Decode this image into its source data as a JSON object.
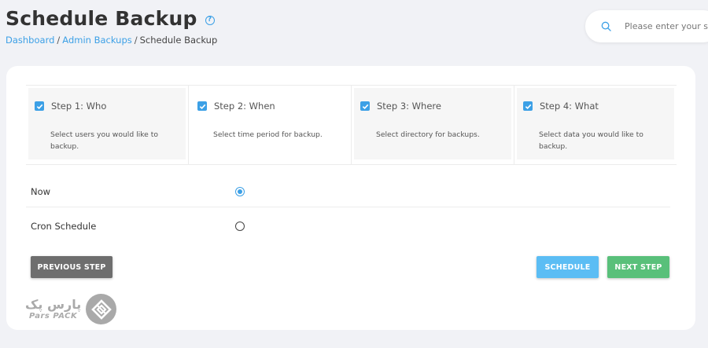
{
  "page": {
    "title": "Schedule Backup"
  },
  "breadcrumb": {
    "items": [
      "Dashboard",
      "Admin Backups",
      "Schedule Backup"
    ],
    "separator": "/"
  },
  "search": {
    "placeholder": "Please enter your search"
  },
  "steps": [
    {
      "title": "Step 1: Who",
      "description": "Select users you would like to backup.",
      "checked": true,
      "active": false
    },
    {
      "title": "Step 2: When",
      "description": "Select time period for backup.",
      "checked": true,
      "active": true
    },
    {
      "title": "Step 3: Where",
      "description": "Select directory for backups.",
      "checked": true,
      "active": false
    },
    {
      "title": "Step 4: What",
      "description": "Select data you would like to backup.",
      "checked": true,
      "active": false
    }
  ],
  "options": [
    {
      "label": "Now",
      "selected": true
    },
    {
      "label": "Cron Schedule",
      "selected": false
    }
  ],
  "buttons": {
    "previous": "PREVIOUS STEP",
    "schedule": "SCHEDULE",
    "next": "NEXT STEP"
  },
  "logo": {
    "persian": "پارس پک",
    "english": "Pars PACK"
  },
  "colors": {
    "accent": "#3ca0e6",
    "previous": "#6e6e6e",
    "schedule": "#5bbdf4",
    "next": "#59c07a"
  },
  "icons": {
    "help": "question-circle-icon",
    "search": "search-icon",
    "checkbox": "checkbox-checked-icon",
    "logo": "parspack-logo-icon"
  }
}
